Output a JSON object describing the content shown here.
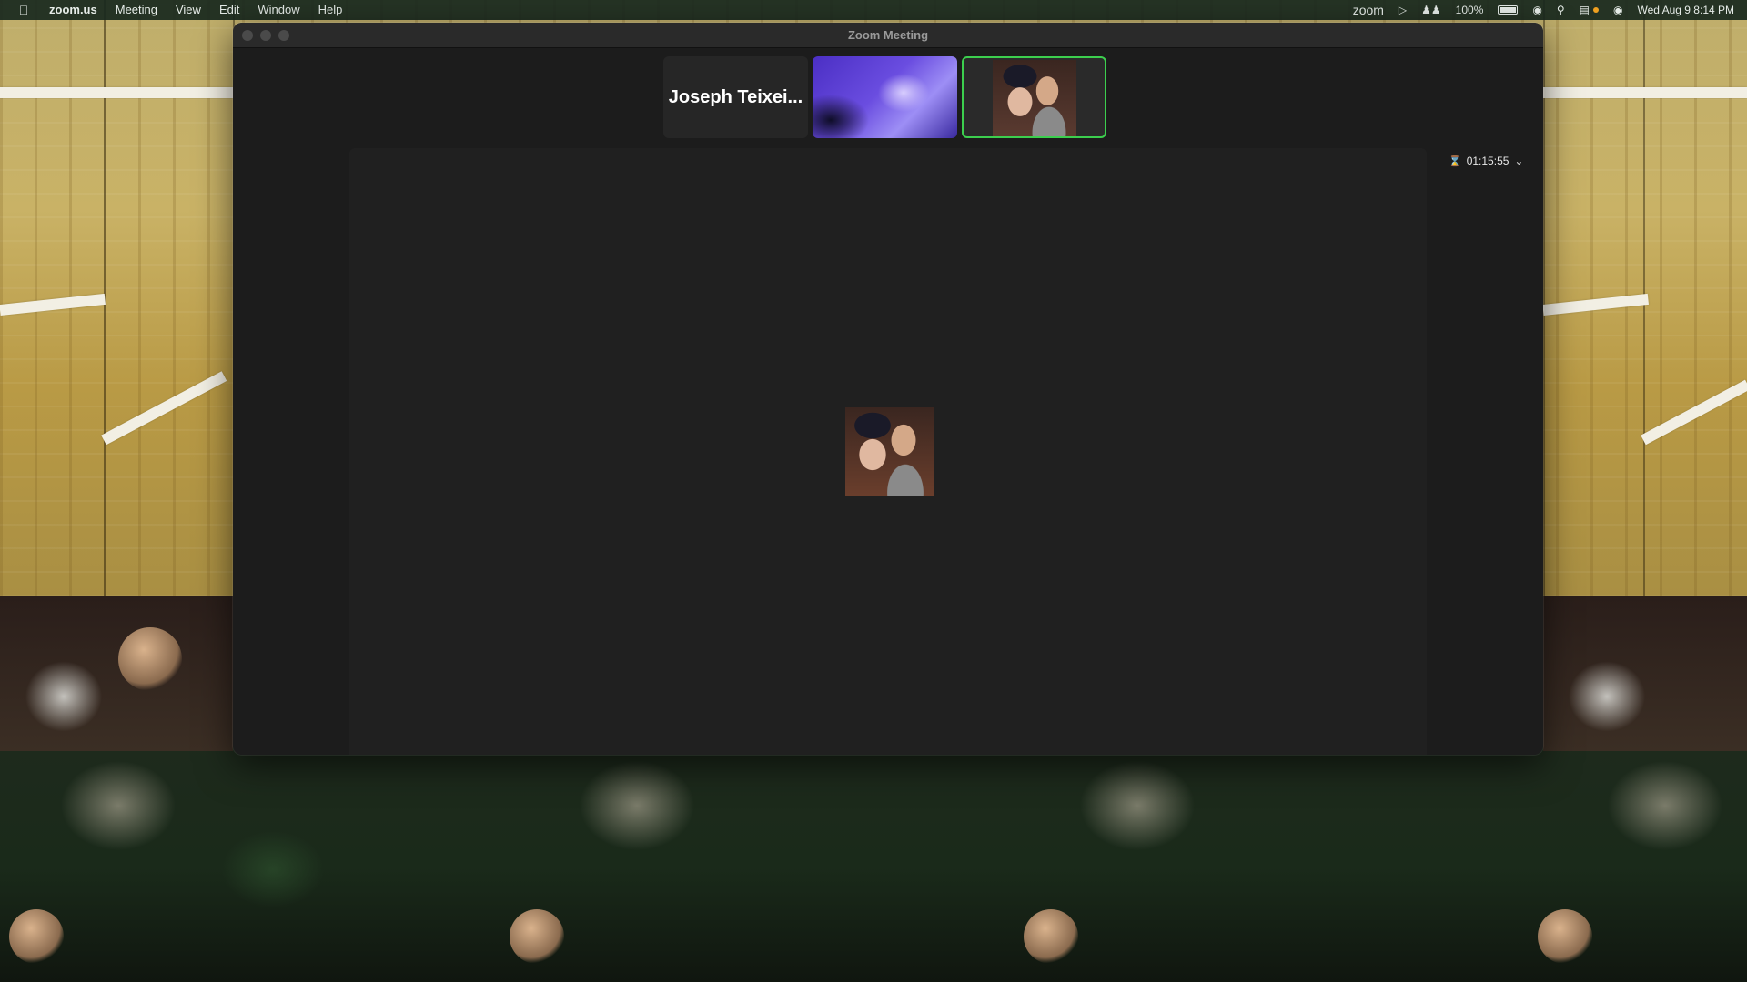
{
  "menubar": {
    "apple_icon": "apple-icon",
    "items": [
      "zoom.us",
      "Meeting",
      "View",
      "Edit",
      "Window",
      "Help"
    ],
    "status": {
      "zoom_label": "zoom",
      "battery_percent": "100%",
      "datetime": "Wed Aug 9  8:14 PM"
    }
  },
  "window": {
    "title": "Zoom Meeting"
  },
  "participants": {
    "name_tile": "Joseph Teixei...",
    "active_border_color": "#3ccf4e"
  },
  "meeting": {
    "elapsed": "01:15:55"
  }
}
